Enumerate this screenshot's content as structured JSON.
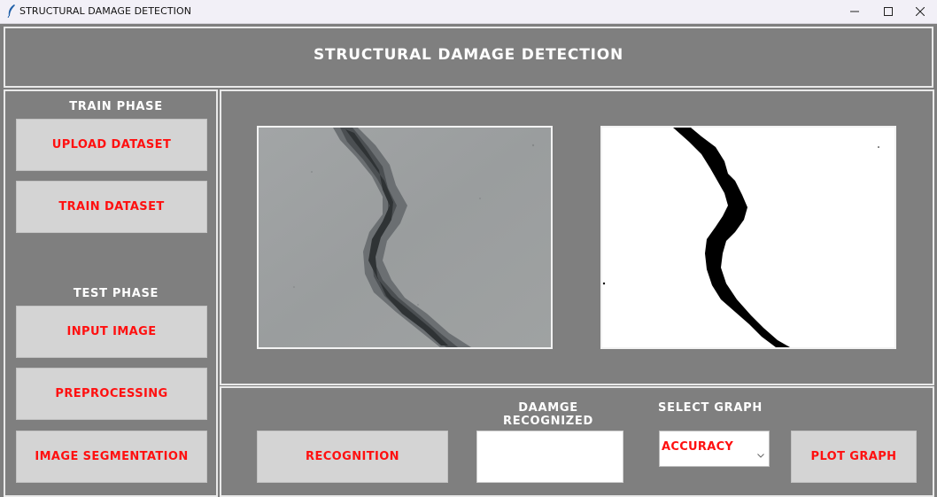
{
  "window": {
    "title": "STRUCTURAL DAMAGE DETECTION",
    "minimize_icon": "minimize-icon",
    "maximize_icon": "maximize-icon",
    "close_icon": "close-icon"
  },
  "header": {
    "title": "STRUCTURAL DAMAGE DETECTION"
  },
  "sidebar": {
    "train_label": "TRAIN PHASE",
    "upload_button": "UPLOAD DATASET",
    "train_button": "TRAIN DATASET",
    "test_label": "TEST PHASE",
    "input_button": "INPUT IMAGE",
    "preprocess_button": "PREPROCESSING",
    "segmentation_button": "IMAGE SEGMENTATION"
  },
  "images": {
    "input": "cracked-concrete-photo",
    "segmented": "binary-crack-mask"
  },
  "bottom": {
    "recognition_button": "RECOGNITION",
    "damage_label": "DAAMGE RECOGNIZED",
    "damage_value": "",
    "graph_label": "SELECT  GRAPH",
    "graph_selected": "ACCURACY",
    "plot_button": "PLOT GRAPH"
  },
  "colors": {
    "background": "#7f7f7f",
    "button_bg": "#d4d4d4",
    "button_text": "#ff1010",
    "label_text": "#ffffff"
  }
}
